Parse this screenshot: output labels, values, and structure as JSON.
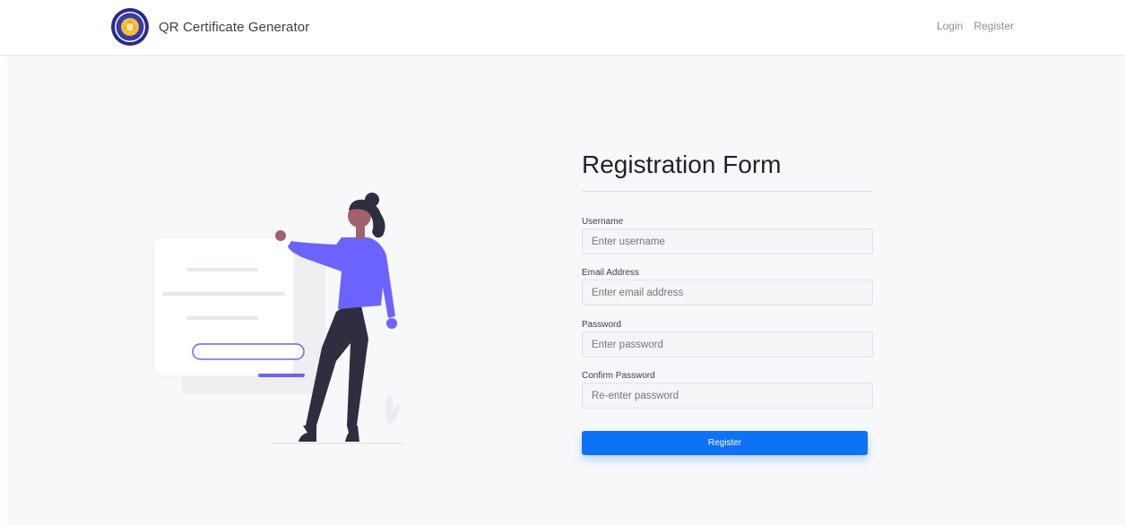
{
  "header": {
    "brand_name": "QR Certificate Generator",
    "nav": {
      "login": "Login",
      "register": "Register"
    }
  },
  "form": {
    "title": "Registration Form",
    "fields": [
      {
        "label": "Username",
        "placeholder": "Enter username",
        "value": ""
      },
      {
        "label": "Email Address",
        "placeholder": "Enter email address",
        "value": ""
      },
      {
        "label": "Password",
        "placeholder": "Enter password",
        "value": ""
      },
      {
        "label": "Confirm Password",
        "placeholder": "Re-enter password",
        "value": ""
      }
    ],
    "submit_label": "Register"
  },
  "icons": {
    "logo": "university-seal-icon"
  },
  "colors": {
    "accent": "#0d72f5",
    "illustration_accent": "#6c63ff",
    "logo_ring": "#2b2a8c",
    "logo_center": "#f2c230"
  }
}
